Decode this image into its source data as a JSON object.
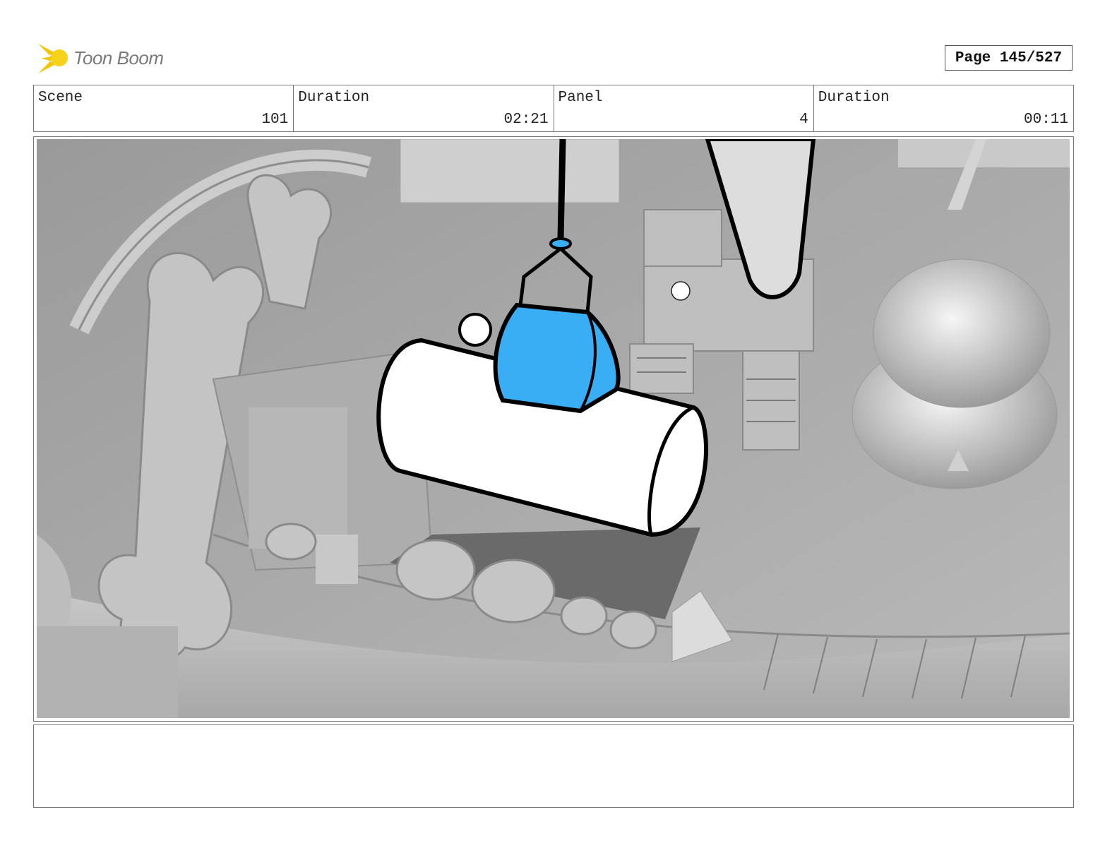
{
  "header": {
    "logo_text": "Toon Boom",
    "page_label": "Page 145/527"
  },
  "info": {
    "scene_label": "Scene",
    "scene_value": "101",
    "scene_duration_label": "Duration",
    "scene_duration_value": "02:21",
    "panel_label": "Panel",
    "panel_value": "4",
    "panel_duration_label": "Duration",
    "panel_duration_value": "00:11"
  },
  "colors": {
    "accent_blue": "#3aaef5",
    "logo_yellow": "#f5c400"
  },
  "notes": {
    "text": ""
  }
}
